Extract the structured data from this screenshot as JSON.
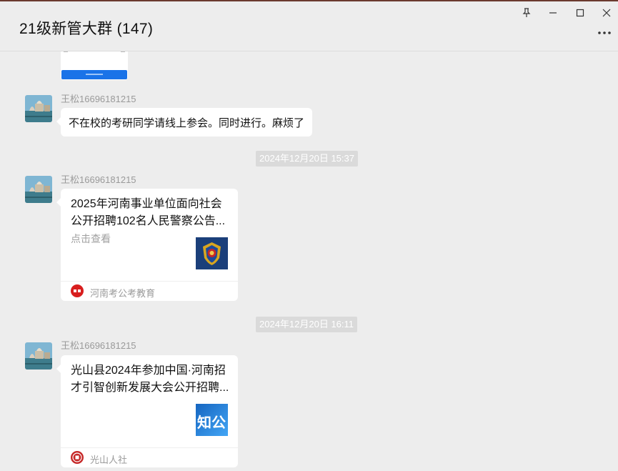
{
  "window": {
    "title": "21级新管大群 (147)",
    "controls": {
      "pin_icon": "pin-icon",
      "minimize_icon": "minimize-icon",
      "maximize_icon": "maximize-icon",
      "close_icon": "close-icon",
      "more_icon": "more-icon"
    }
  },
  "messages": [
    {
      "type": "text",
      "sender": "王松16696181215",
      "text": "不在校的考研同学请线上参会。同时进行。麻烦了"
    },
    {
      "type": "timestamp",
      "text": "2024年12月20日 15:37"
    },
    {
      "type": "card",
      "sender": "王松16696181215",
      "title": "2025年河南事业单位面向社会公开招聘102名人民警察公告...",
      "subtitle": "点击查看",
      "source": "河南考公考教育",
      "thumbnail": "police-emblem-icon"
    },
    {
      "type": "timestamp",
      "text": "2024年12月20日 16:11"
    },
    {
      "type": "card",
      "sender": "王松16696181215",
      "title": "光山县2024年参加中国·河南招才引智创新发展大会公开招聘...",
      "thumb_text": "知公",
      "source": "光山人社"
    }
  ],
  "colors": {
    "background": "#ededed",
    "bubble": "#ffffff",
    "timestamp_bg": "#dadada",
    "accent_blue": "#1a73e8"
  }
}
